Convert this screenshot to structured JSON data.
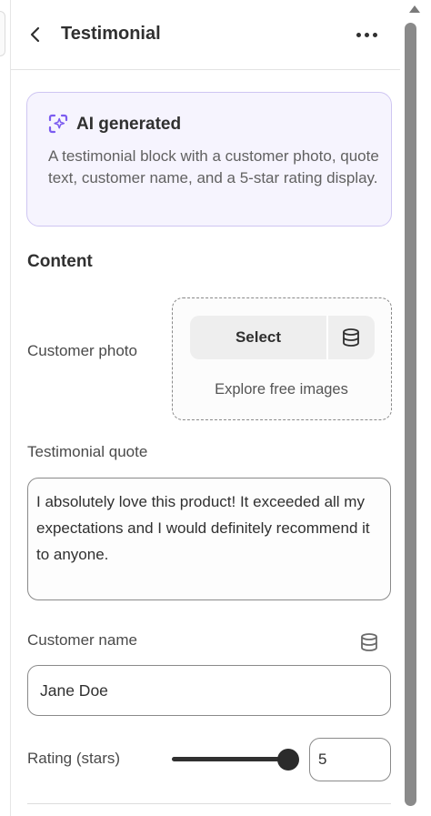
{
  "header": {
    "title": "Testimonial",
    "back_icon": "chevron-left-icon",
    "more_icon": "more-horizontal-icon"
  },
  "ai_card": {
    "icon": "ai-sparkle-icon",
    "title": "AI generated",
    "description": "A testimonial block with a customer photo, quote text, customer name, and a 5-star rating display.",
    "accent_color": "#7c5cf0"
  },
  "content": {
    "section_title": "Content",
    "photo": {
      "label": "Customer photo",
      "select_label": "Select",
      "db_icon": "database-icon",
      "explore_label": "Explore free images"
    },
    "quote": {
      "label": "Testimonial quote",
      "value": "I absolutely love this product! It exceeded all my expectations and I would definitely recommend it to anyone."
    },
    "name": {
      "label": "Customer name",
      "db_icon": "database-icon",
      "value": "Jane Doe"
    },
    "rating": {
      "label": "Rating (stars)",
      "value": "5",
      "slider_fraction": 1.0
    }
  }
}
